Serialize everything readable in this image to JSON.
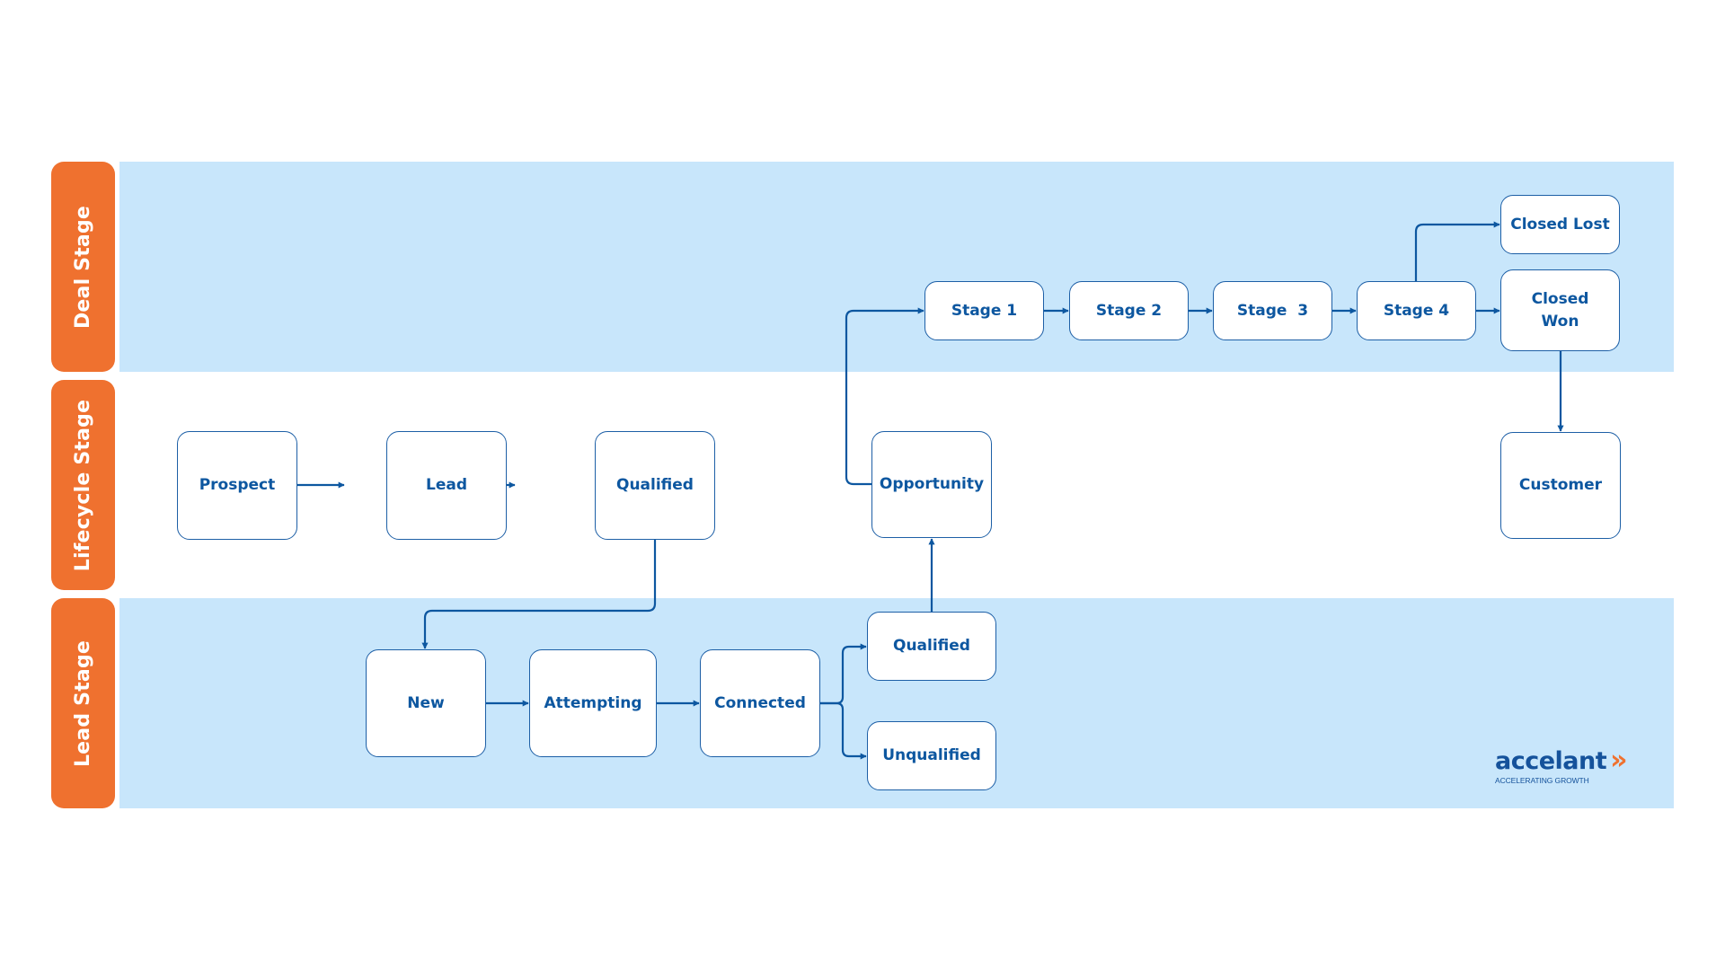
{
  "lanes": {
    "deal": {
      "label": "Deal Stage"
    },
    "lifecycle": {
      "label": "Lifecycle Stage"
    },
    "lead": {
      "label": "Lead Stage"
    }
  },
  "nodes": {
    "stage1": "Stage 1",
    "stage2": "Stage 2",
    "stage3": "Stage  3",
    "stage4": "Stage 4",
    "closed_lost": "Closed Lost",
    "closed_won": "Closed\nWon",
    "prospect": "Prospect",
    "lead": "Lead",
    "lifecycle_qualified": "Qualified",
    "opportunity": "Opportunity",
    "customer": "Customer",
    "new": "New",
    "attempting": "Attempting",
    "connected": "Connected",
    "lead_qualified": "Qualified",
    "unqualified": "Unqualified"
  },
  "logo": {
    "wordmark": "accelant",
    "chevrons": "»",
    "tagline": "ACCELERATING GROWTH"
  },
  "colors": {
    "lane_label": "#ef712f",
    "band": "#c8e6fb",
    "node_border": "#1d5fa6",
    "node_text": "#0d57a0",
    "connector": "#0d57a0"
  }
}
